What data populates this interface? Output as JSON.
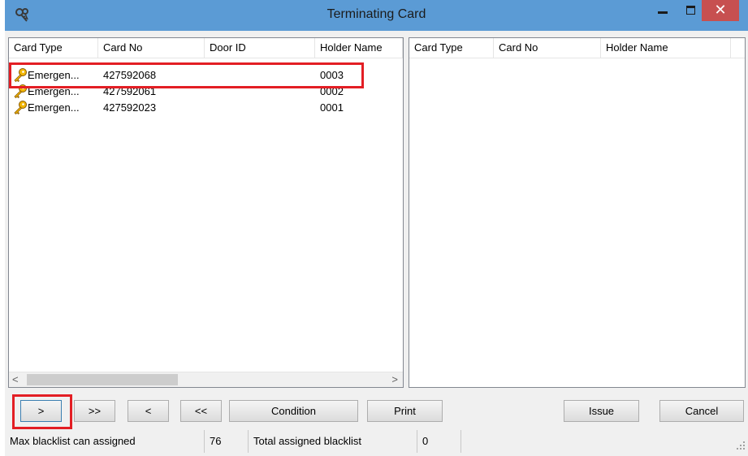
{
  "window": {
    "title": "Terminating Card",
    "close_glyph": "✕"
  },
  "left_table": {
    "columns": [
      "Card Type",
      "Card No",
      "Door ID",
      "Holder Name"
    ],
    "rows": [
      {
        "icon": "key-icon",
        "card_type": "Emergen...",
        "card_no": "427592068",
        "door_id": "",
        "holder_name": "0003"
      },
      {
        "icon": "key-icon",
        "card_type": "Emergen...",
        "card_no": "427592061",
        "door_id": "",
        "holder_name": "0002"
      },
      {
        "icon": "key-icon",
        "card_type": "Emergen...",
        "card_no": "427592023",
        "door_id": "",
        "holder_name": "0001"
      }
    ],
    "scroll_left": "<",
    "scroll_right": ">"
  },
  "right_table": {
    "columns": [
      "Card Type",
      "Card No",
      "Holder Name"
    ]
  },
  "buttons": {
    "move_one": ">",
    "move_all": ">>",
    "remove_one": "<",
    "remove_all": "<<",
    "condition": "Condition",
    "print": "Print",
    "issue": "Issue",
    "cancel": "Cancel"
  },
  "status": {
    "max_label": "Max blacklist can assigned",
    "max_value": "76",
    "total_label": "Total assigned blacklist",
    "total_value": "0"
  },
  "colors": {
    "titlebar": "#5b9bd5",
    "close": "#c75050",
    "highlight": "#e31e24"
  }
}
